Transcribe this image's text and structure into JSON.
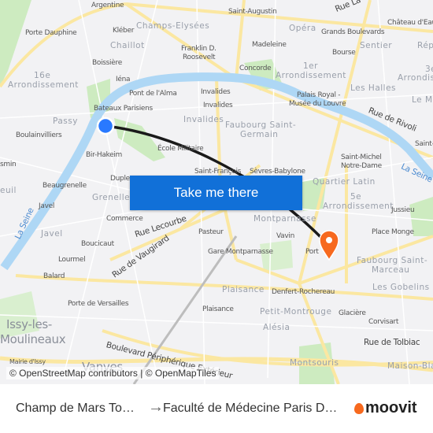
{
  "map": {
    "labels": {
      "argentine": "Argentine",
      "saint_augustin": "Saint-Augustin",
      "rue_la": "Rue La",
      "chateau": "Château d'Eau",
      "porte_dauphine": "Porte Dauphine",
      "kleber": "Kléber",
      "champs": "Champs-Elysées",
      "opera": "Opéra",
      "grands_blvd": "Grands Boulevards",
      "chaillot": "Chaillot",
      "franklin": "Franklin D.",
      "roosevelt": "Roosevelt",
      "madeleine": "Madeleine",
      "sentier": "Sentier",
      "bourse": "Bourse",
      "rep": "Rép",
      "boissiere": "Boissière",
      "concorde": "Concorde",
      "arr1a": "1er",
      "arr1b": "Arrondissement",
      "arr3a": "3e",
      "arr3b": "Arrondis",
      "arr16a": "16e",
      "arr16b": "Arrondissement",
      "iena": "Iéna",
      "les_halles": "Les Halles",
      "le_ma": "Le Ma",
      "pont_alma": "Pont de l'Alma",
      "invalides1": "Invalides",
      "invalides2": "Invalides",
      "palais": "Palais Royal -",
      "louvre": "Musée du Louvre",
      "bateaux": "Bateaux Parisiens",
      "passy": "Passy",
      "invalides_d": "Invalides",
      "faubourg1": "Faubourg Saint-",
      "faubourg2": "Germain",
      "rivoli": "Rue de Rivoli",
      "boulainvilliers": "Boulainvilliers",
      "ecole": "École Militaire",
      "saint_l": "Saint-L",
      "bir": "Bir-Hakeim",
      "smin": "smin",
      "saint_michel": "Saint-Michel",
      "notre_dame": "Notre-Dame",
      "la_seine_r": "La Seine",
      "saint_francois": "Saint-François",
      "sevres": "Sèvres-Babylone",
      "euil": "euil",
      "beaugrenelle": "Beaugrenelle",
      "duple": "Duple",
      "quartier_latin": "Quartier Latin",
      "grenelle": "Grenelle",
      "javel1": "Javel",
      "arr5a": "5e",
      "arr5b": "Arrondissement",
      "jussieu": "Jussieu",
      "la_seine_l": "La Seine",
      "commerce": "Commerce",
      "montparnasse": "Montparnasse",
      "rue_lecourbe": "Rue Lecourbe",
      "javel2": "Javel",
      "pasteur": "Pasteur",
      "vavin": "Vavin",
      "place_monge": "Place Monge",
      "boucicaut": "Boucicaut",
      "lourmel": "Lourmel",
      "rue_vaugirard": "Rue de Vaugirard",
      "gare_mp": "Gare Montparnasse",
      "port": "Port",
      "faubourg_sm1": "Faubourg Saint-",
      "faubourg_sm2": "Marceau",
      "balard": "Balard",
      "plaisance1": "Plaisance",
      "denfert": "Denfert-Rochereau",
      "gobelins": "Les Gobelins",
      "porte_versailles": "Porte de Versailles",
      "petit_montrouge": "Petit-Montrouge",
      "plaisance2": "Plaisance",
      "glaciere": "Glacière",
      "issy1": "Issy-les-",
      "issy2": "Moulineaux",
      "blvd_peri": "Boulevard Périphérique Extérieur",
      "alesia": "Alésia",
      "corvisart": "Corvisart",
      "tolbiac": "Rue de Tolbiac",
      "malakoff": "Mairie d'Issy",
      "vanves": "Vanves",
      "montsouris": "Montsouris",
      "maison_bla": "Maison-Bla"
    },
    "origin_marker": {
      "color": "#2979ff",
      "icon": "origin-dot-icon"
    },
    "destination_marker": {
      "color": "#f7691e",
      "icon": "destination-pin-icon"
    },
    "route_color": "#1a1a1a",
    "cta_label": "Take me there",
    "attribution": "© OpenStreetMap contributors | © OpenMapTiles"
  },
  "footer": {
    "from": "Champ de Mars To…",
    "arrow_icon": "arrow-right-icon",
    "to": "Faculté de Médecine Paris D…",
    "brand": "moovit",
    "brand_color": "#f7691e"
  }
}
